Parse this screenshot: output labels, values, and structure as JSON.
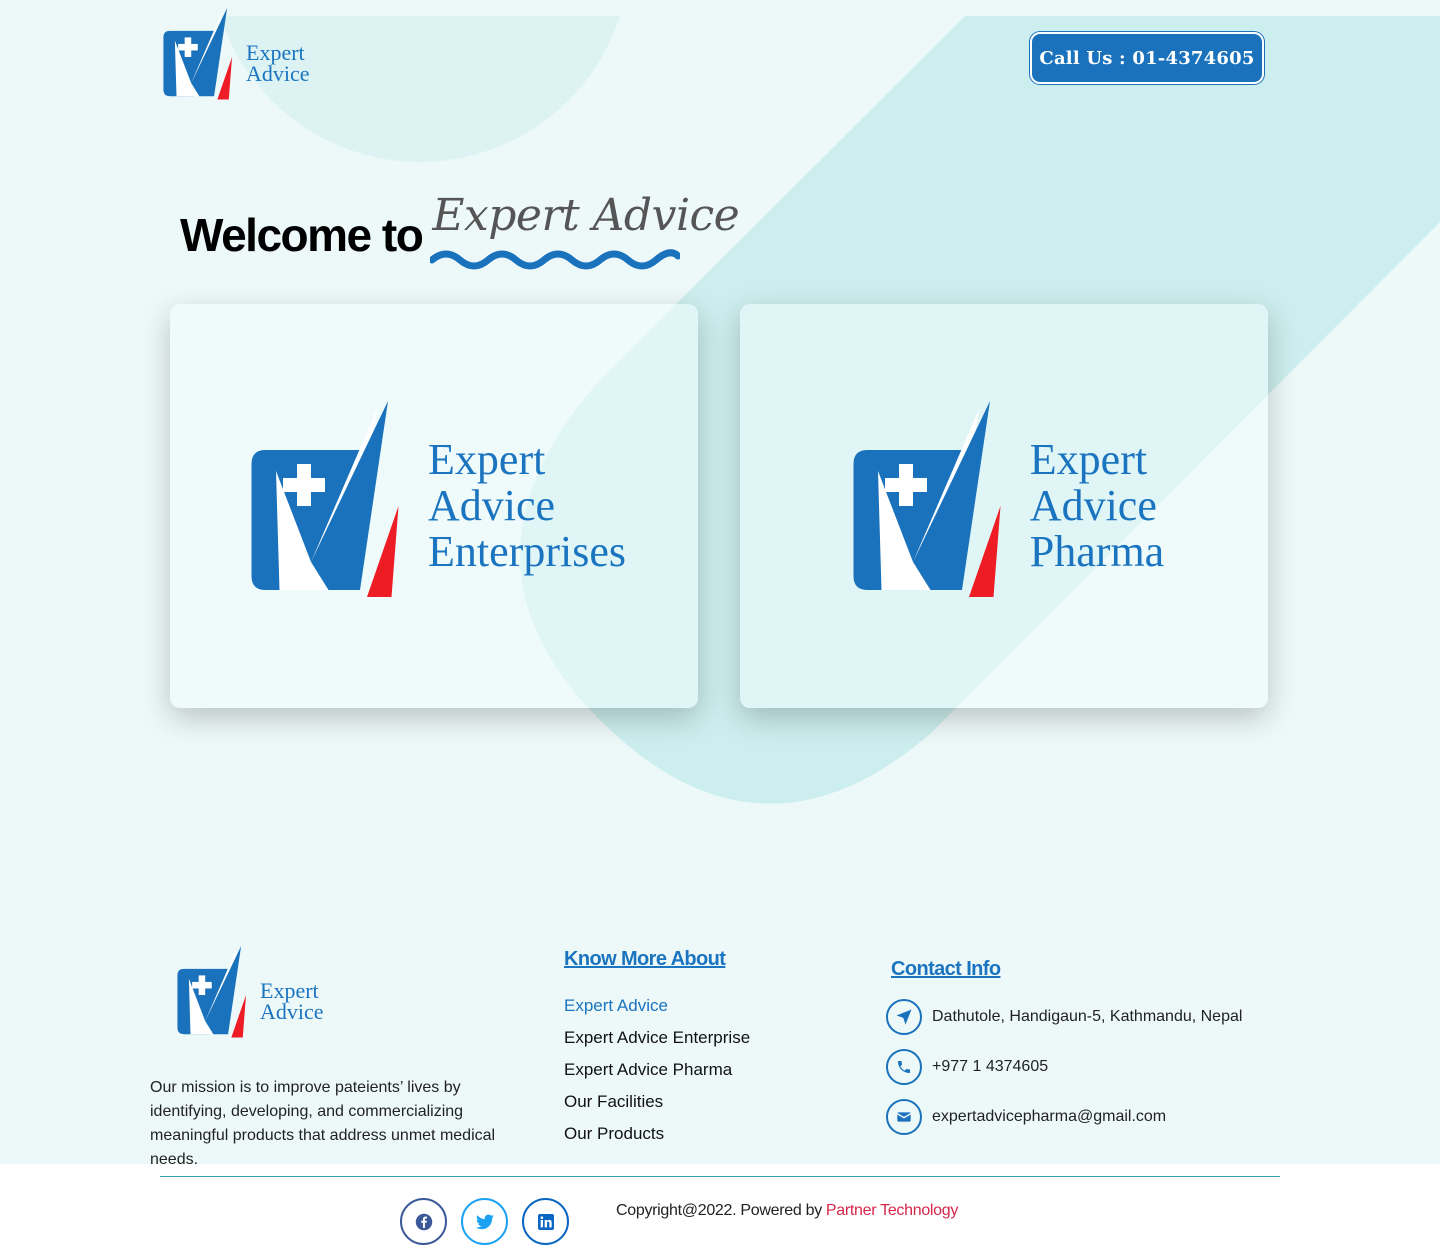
{
  "brand": {
    "logo_line1": "Expert",
    "logo_line2": "Advice",
    "primary_color": "#1a74bf",
    "accent_color": "#ee1c25"
  },
  "header": {
    "call_label": "Call Us : 01-4374605"
  },
  "welcome": {
    "lead": "Welcome to",
    "script": "Expert Advice"
  },
  "cards": [
    {
      "line1": "Expert",
      "line2": "Advice",
      "line3": "Enterprises"
    },
    {
      "line1": "Expert",
      "line2": "Advice",
      "line3": "Pharma"
    }
  ],
  "footer": {
    "mission": "Our mission is to improve pateients’ lives by identifying, developing, and commercializing meaningful products that address unmet medical needs.",
    "know_more": {
      "title": "Know More About",
      "items": [
        "Expert Advice",
        "Expert Advice Enterprise",
        "Expert Advice Pharma",
        "Our Facilities",
        "Our Products"
      ]
    },
    "contact": {
      "title": "Contact Info",
      "address": "Dathutole, Handigaun-5, Kathmandu, Nepal",
      "phone": "+977 1 4374605",
      "email": "expertadvicepharma@gmail.com"
    },
    "social_icons": [
      "facebook-icon",
      "twitter-icon",
      "linkedin-icon"
    ],
    "copyright": "Copyright@2022. Powered by",
    "powered_by": "Partner Technology"
  }
}
